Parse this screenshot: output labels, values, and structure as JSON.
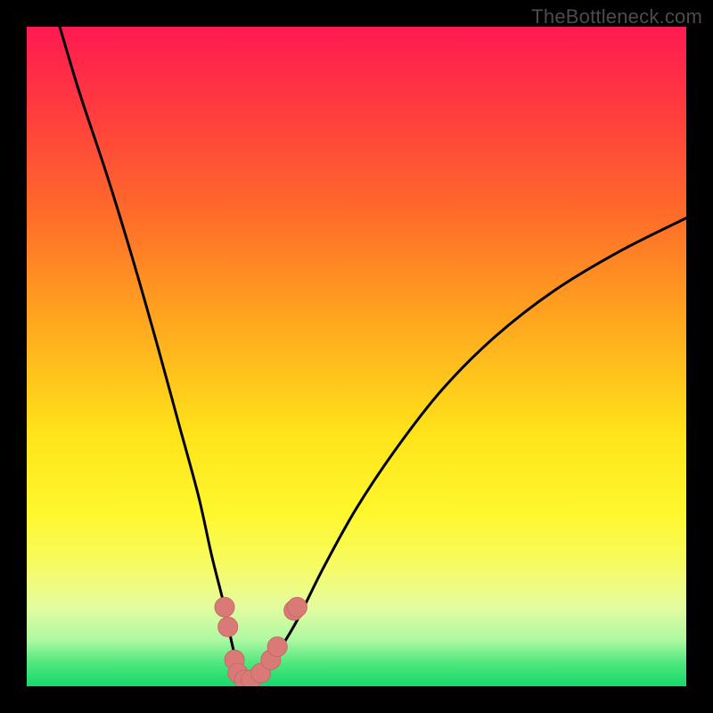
{
  "watermark": "TheBottleneck.com",
  "colors": {
    "black": "#000000",
    "curve": "#000000",
    "markers": "#d97a77",
    "marker_stroke": "#c66a67",
    "gradient_stops": [
      {
        "offset": 0.0,
        "color": "#ff1a52"
      },
      {
        "offset": 0.12,
        "color": "#ff3a3f"
      },
      {
        "offset": 0.28,
        "color": "#ff6a2a"
      },
      {
        "offset": 0.45,
        "color": "#ffa81e"
      },
      {
        "offset": 0.62,
        "color": "#ffe41a"
      },
      {
        "offset": 0.74,
        "color": "#fff82e"
      },
      {
        "offset": 0.82,
        "color": "#f6fb66"
      },
      {
        "offset": 0.88,
        "color": "#e4fca0"
      },
      {
        "offset": 0.93,
        "color": "#aef8a2"
      },
      {
        "offset": 0.965,
        "color": "#4fe77e"
      },
      {
        "offset": 1.0,
        "color": "#15d96a"
      }
    ]
  },
  "chart_data": {
    "type": "line",
    "title": "",
    "xlabel": "",
    "ylabel": "",
    "xlim": [
      0,
      100
    ],
    "ylim": [
      0,
      100
    ],
    "grid": false,
    "series": [
      {
        "name": "bottleneck-curve",
        "x": [
          5,
          8,
          12,
          16,
          20,
          23,
          26,
          28,
          30,
          31,
          32,
          33,
          34,
          36,
          38,
          41,
          45,
          50,
          56,
          63,
          71,
          80,
          90,
          100
        ],
        "y": [
          100,
          90,
          78,
          65,
          51,
          40,
          29,
          20,
          12,
          7,
          3,
          1,
          1,
          2,
          5,
          10,
          18,
          27,
          36,
          45,
          53,
          60,
          66,
          71
        ]
      }
    ],
    "markers": [
      {
        "x": 30.0,
        "y": 12.0
      },
      {
        "x": 30.5,
        "y": 9.0
      },
      {
        "x": 31.5,
        "y": 4.0
      },
      {
        "x": 32.0,
        "y": 2.0
      },
      {
        "x": 33.0,
        "y": 1.0
      },
      {
        "x": 34.0,
        "y": 1.0
      },
      {
        "x": 35.5,
        "y": 2.0
      },
      {
        "x": 37.0,
        "y": 4.0
      },
      {
        "x": 38.0,
        "y": 6.0
      },
      {
        "x": 40.5,
        "y": 11.5
      },
      {
        "x": 41.0,
        "y": 12.0
      }
    ]
  }
}
